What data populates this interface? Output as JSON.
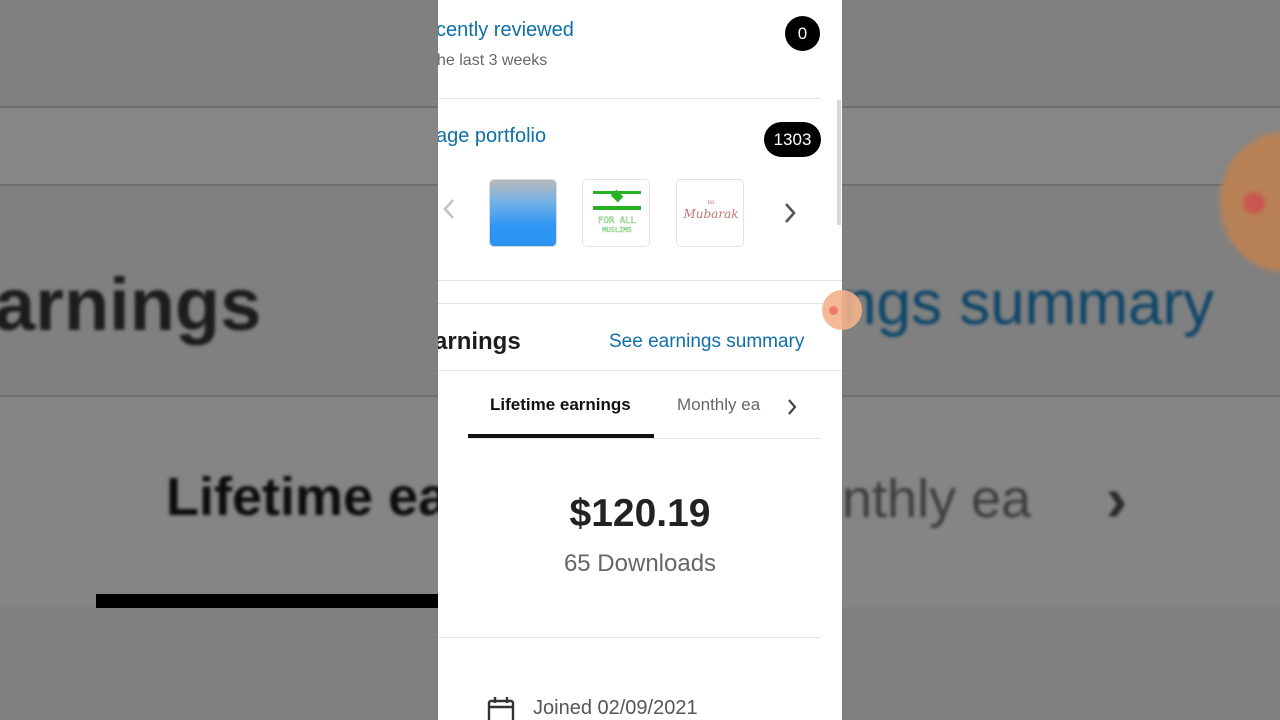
{
  "background": {
    "heading_left": "arnings",
    "heading_right": "ngs summary",
    "tab_left": "Lifetime ea",
    "tab_right": "nthly ea",
    "chevron": "›"
  },
  "recently_reviewed": {
    "title": "cently reviewed",
    "subtitle": "he last 3 weeks",
    "count": "0"
  },
  "portfolio": {
    "title": "age portfolio",
    "count": "1303",
    "prev_icon": "chevron-left",
    "next_icon": "chevron-right",
    "thumbnails": [
      {
        "name": "blue-gradient-image"
      },
      {
        "name": "for-all-muslims-image",
        "text_line1": "FOR ALL",
        "text_line2": "MUSLIMS"
      },
      {
        "name": "eid-mubarak-image",
        "text_small": "EID",
        "text_main": "Mubarak"
      }
    ]
  },
  "earnings": {
    "title": "arnings",
    "summary_link": "See earnings summary",
    "tabs": [
      {
        "label": "Lifetime earnings",
        "active": true
      },
      {
        "label": "Monthly ea",
        "active": false
      }
    ],
    "amount": "$120.19",
    "downloads": "65 Downloads"
  },
  "profile": {
    "joined": "Joined 02/09/2021",
    "icon": "calendar-icon"
  },
  "colors": {
    "link": "#0f6fa9",
    "pill": "#000000",
    "underline": "#111111"
  }
}
